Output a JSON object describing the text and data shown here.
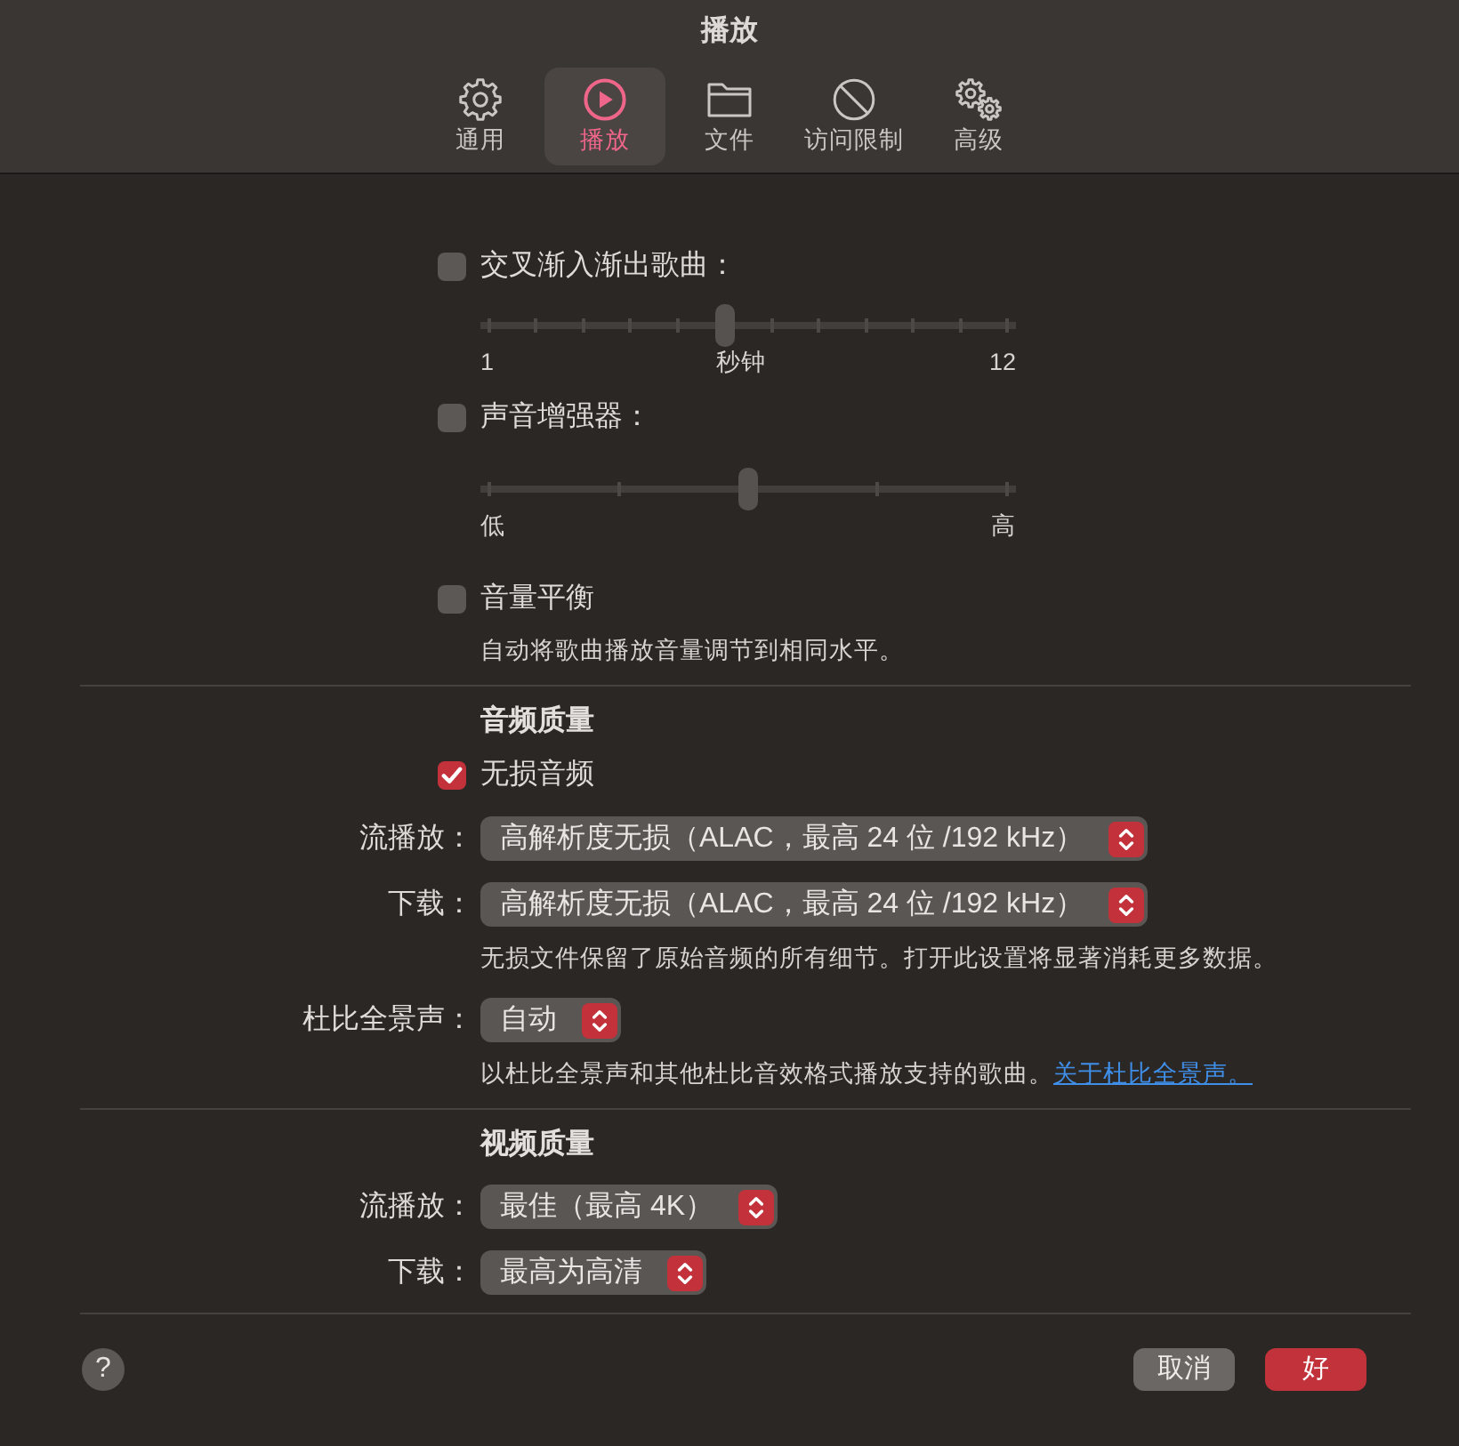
{
  "window": {
    "title": "播放"
  },
  "tabs": [
    {
      "kind": "gear",
      "label": "通用",
      "selected": false
    },
    {
      "kind": "play",
      "label": "播放",
      "selected": true
    },
    {
      "kind": "folder",
      "label": "文件",
      "selected": false
    },
    {
      "kind": "restriction",
      "label": "访问限制",
      "selected": false
    },
    {
      "kind": "gears",
      "label": "高级",
      "selected": false
    }
  ],
  "settings": [
    {
      "kind": "checkbox",
      "label": "交叉渐入渐出歌曲：",
      "checked": false
    },
    {
      "kind": "slider",
      "disabled": true,
      "level": 0.4545,
      "labels": [
        "1",
        "秒钟",
        "12"
      ]
    },
    {
      "kind": "checkbox",
      "label": "声音增强器：",
      "checked": false
    },
    {
      "kind": "slider",
      "disabled": true,
      "level": 0.5,
      "labels": [
        "低",
        "高"
      ]
    },
    {
      "kind": "checkbox",
      "label": "音量平衡",
      "checked": false
    },
    {
      "kind": "note",
      "text": "自动将歌曲播放音量调节到相同水平。"
    },
    {
      "kind": "divider"
    },
    {
      "kind": "heading",
      "text": "音频质量"
    },
    {
      "kind": "checkbox",
      "label": "无损音频",
      "checked": true
    },
    {
      "kind": "select",
      "label": "流播放：",
      "value": "高解析度无损（ALAC，最高 24 位 /192 kHz）"
    },
    {
      "kind": "select",
      "label": "下载：",
      "value": "高解析度无损（ALAC，最高 24 位 /192 kHz）"
    },
    {
      "kind": "note",
      "text": "无损文件保留了原始音频的所有细节。打开此设置将显著消耗更多数据。"
    },
    {
      "kind": "select",
      "label": "杜比全景声：",
      "value": "自动"
    },
    {
      "kind": "note",
      "text": "以杜比全景声和其他杜比音效格式播放支持的歌曲。",
      "link": "关于杜比全景声。"
    },
    {
      "kind": "divider"
    },
    {
      "kind": "heading",
      "text": "视频质量"
    },
    {
      "kind": "select",
      "label": "流播放：",
      "value": "最佳（最高 4K）"
    },
    {
      "kind": "select",
      "label": "下载：",
      "value": "最高为高清"
    }
  ],
  "footer": {
    "help": "?",
    "buttons": [
      {
        "label": "取消",
        "default": false
      },
      {
        "label": "好",
        "default": true
      }
    ]
  }
}
